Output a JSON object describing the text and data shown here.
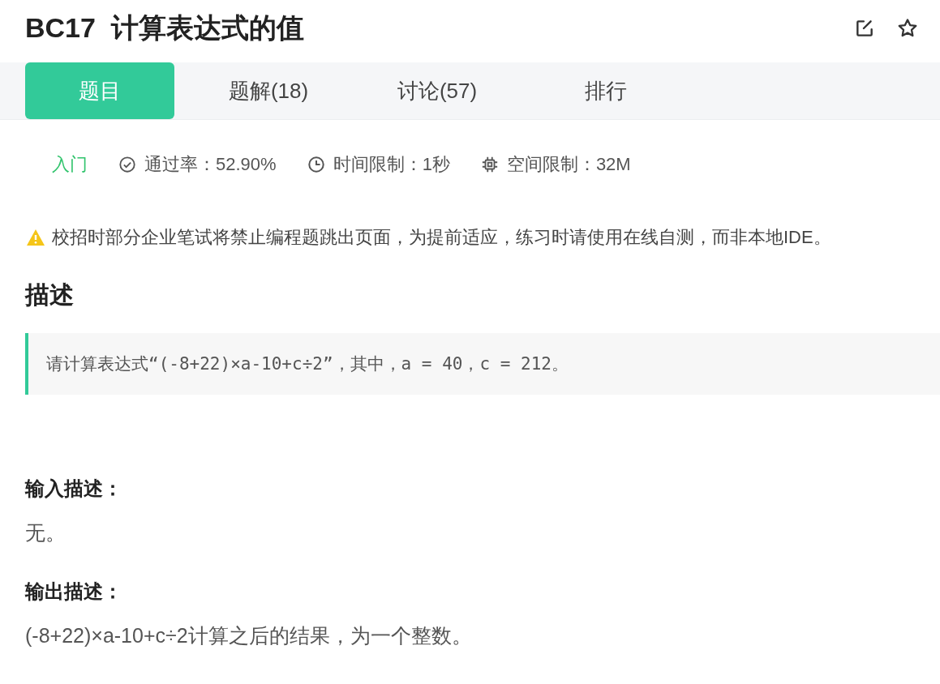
{
  "title": "BC17  计算表达式的值",
  "tabs": [
    {
      "label": "题目",
      "selected": true
    },
    {
      "label": "题解(18)",
      "selected": false
    },
    {
      "label": "讨论(57)",
      "selected": false
    },
    {
      "label": "排行",
      "selected": false
    }
  ],
  "meta": {
    "difficulty": "入门",
    "pass_rate": "通过率：52.90%",
    "time_limit": "时间限制：1秒",
    "memory_limit": "空间限制：32M"
  },
  "notice": "校招时部分企业笔试将禁止编程题跳出页面，为提前适应，练习时请使用在线自测，而非本地IDE。",
  "description": {
    "heading": "描述",
    "text": "请计算表达式“(-8+22)×a-10+c÷2”，其中，a = 40，c = 212。"
  },
  "sections": [
    {
      "heading": "输入描述：",
      "text": "无。"
    },
    {
      "heading": "输出描述：",
      "text": "(-8+22)×a-10+c÷2计算之后的结果，为一个整数。"
    }
  ]
}
